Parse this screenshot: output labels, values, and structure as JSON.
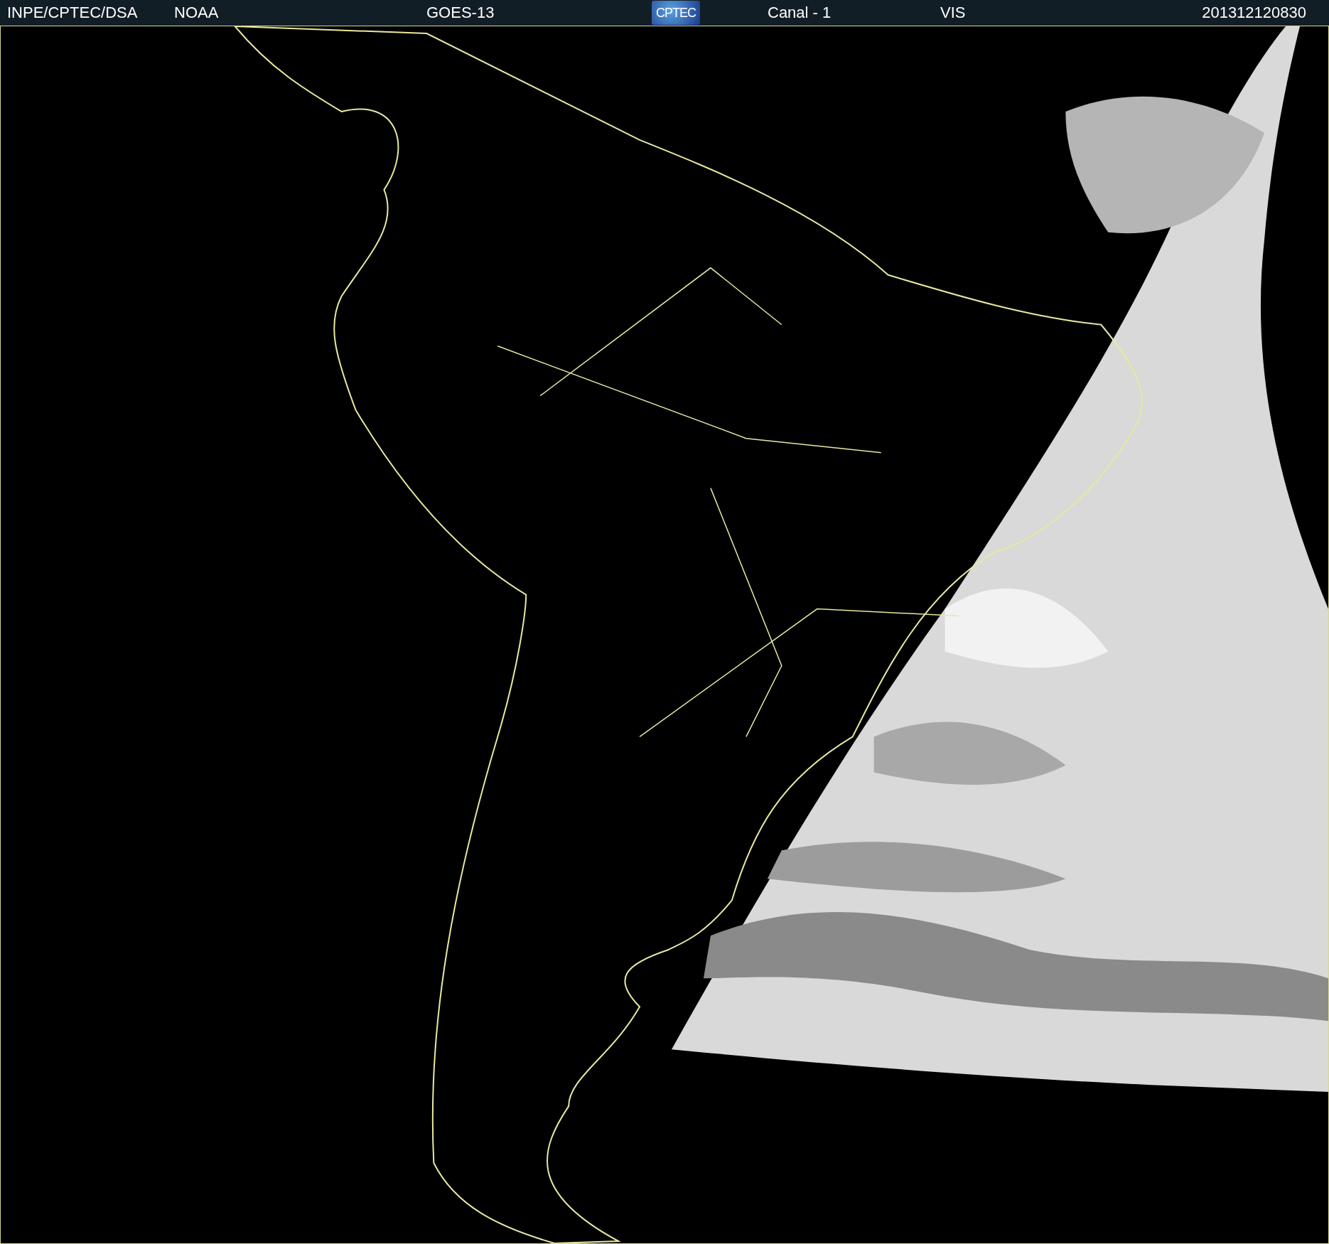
{
  "header": {
    "source": "INPE/CPTEC/DSA",
    "agency": "NOAA",
    "satellite": "GOES-13",
    "logo": "CPTEC",
    "channel": "Canal - 1",
    "band": "VIS",
    "timestamp": "201312120830"
  }
}
